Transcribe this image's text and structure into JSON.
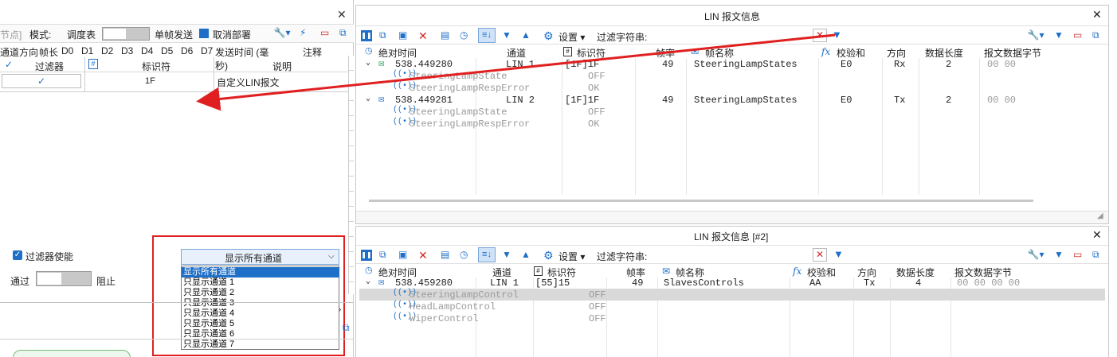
{
  "left_panel": {
    "close_label": "✕",
    "toolbar": {
      "node_label": "节点]",
      "mode_label": "模式:",
      "schedule_label": "调度表",
      "single_send_label": "单帧发送",
      "cancel_deploy_label": "取消部署"
    },
    "columns": [
      "通道",
      "方向",
      "帧长",
      "D0",
      "D1",
      "D2",
      "D3",
      "D4",
      "D5",
      "D6",
      "D7",
      "发送时间 (毫秒)",
      "注释"
    ],
    "filter_table": {
      "headers": [
        "过滤器",
        "#",
        "标识符",
        "说明"
      ],
      "rows": [
        {
          "identifier": "1F",
          "description": "自定义LIN报文"
        }
      ]
    },
    "filter_enable_label": "过滤器使能",
    "pass_label": "通过",
    "block_label": "阻止",
    "channel_select": {
      "selected": "显示所有通道",
      "options": [
        "显示所有通道",
        "只显示通道 1",
        "只显示通道 2",
        "只显示通道 3",
        "只显示通道 4",
        "只显示通道 5",
        "只显示通道 6",
        "只显示通道 7"
      ]
    }
  },
  "panel1": {
    "title": "LIN 报文信息",
    "settings_label": "设置",
    "filter_label": "过滤字符串:",
    "headers": {
      "time": "绝对时间",
      "channel": "通道",
      "id": "标识符",
      "rate": "帧率",
      "name": "帧名称",
      "checksum": "校验和",
      "dir": "方向",
      "len": "数据长度",
      "data": "报文数据字节"
    },
    "rows": [
      {
        "time": "538.449280",
        "channel": "LIN 1",
        "id": "[1F]1F",
        "rate": "49",
        "name": "SteeringLampStates",
        "checksum": "E0",
        "dir": "Rx",
        "len": "2",
        "data": "00 00",
        "signals": [
          {
            "name": "SteeringLampState",
            "value": "OFF"
          },
          {
            "name": "SteeringLampRespError",
            "value": "OK"
          }
        ]
      },
      {
        "time": "538.449281",
        "channel": "LIN 2",
        "id": "[1F]1F",
        "rate": "49",
        "name": "SteeringLampStates",
        "checksum": "E0",
        "dir": "Tx",
        "len": "2",
        "data": "00 00",
        "signals": [
          {
            "name": "SteeringLampState",
            "value": "OFF"
          },
          {
            "name": "SteeringLampRespError",
            "value": "OK"
          }
        ]
      }
    ]
  },
  "panel2": {
    "title": "LIN 报文信息 [#2]",
    "settings_label": "设置",
    "filter_label": "过滤字符串:",
    "headers": {
      "time": "绝对时间",
      "channel": "通道",
      "id": "标识符",
      "rate": "帧率",
      "name": "帧名称",
      "checksum": "校验和",
      "dir": "方向",
      "len": "数据长度",
      "data": "报文数据字节"
    },
    "row": {
      "time": "538.459280",
      "channel": "LIN 1",
      "id": "[55]15",
      "rate": "49",
      "name": "SlavesControls",
      "checksum": "AA",
      "dir": "Tx",
      "len": "4",
      "data": "00 00 00 00",
      "signals": [
        {
          "name": "SteeringLampControl",
          "value": "OFF"
        },
        {
          "name": "HeadLampControl",
          "value": "OFF"
        },
        {
          "name": "WiperControl",
          "value": "OFF"
        }
      ]
    }
  },
  "colors": {
    "accent": "#1e6fc8",
    "highlight_red": "#e02020",
    "selected_option": "#1e6fc8"
  }
}
